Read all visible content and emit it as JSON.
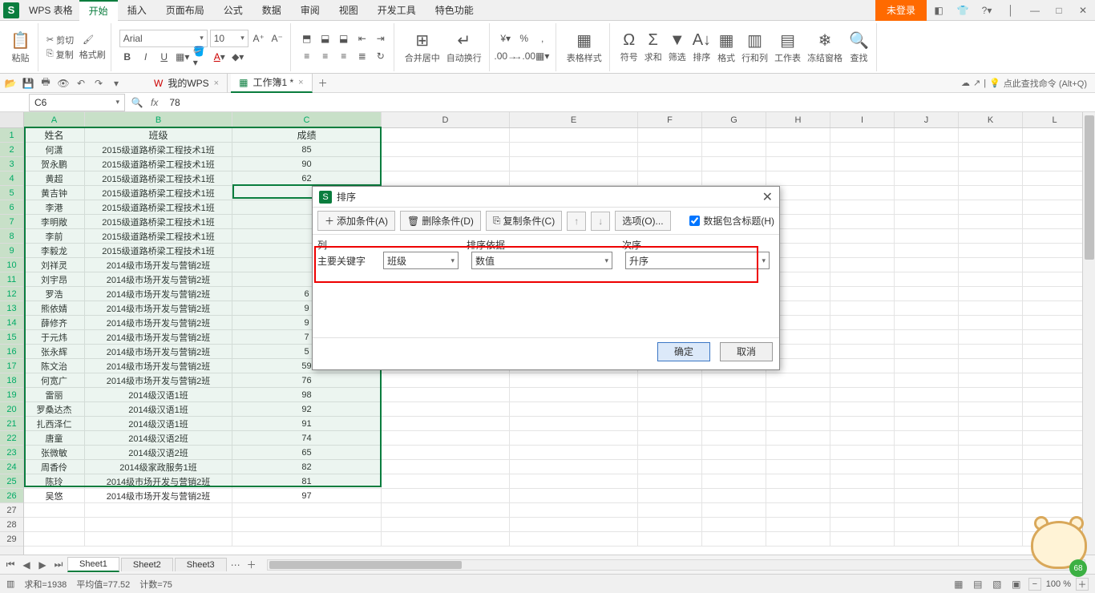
{
  "app": {
    "title": "WPS 表格",
    "login": "未登录"
  },
  "menu": {
    "tabs": [
      "开始",
      "插入",
      "页面布局",
      "公式",
      "数据",
      "审阅",
      "视图",
      "开发工具",
      "特色功能"
    ]
  },
  "ribbon": {
    "paste": "粘贴",
    "cut": "剪切",
    "copy": "复制",
    "fmtpaint": "格式刷",
    "font": "Arial",
    "size": "10",
    "merge": "合并居中",
    "wrap": "自动换行",
    "tablestyle": "表格样式",
    "symbol": "符号",
    "sum": "求和",
    "filter": "筛选",
    "sort": "排序",
    "format": "格式",
    "rowcol": "行和列",
    "worksheet": "工作表",
    "freeze": "冻结窗格",
    "find": "查找"
  },
  "qat": {
    "search": "点此查找命令 (Alt+Q)"
  },
  "doctabs": {
    "wps": "我的WPS",
    "book": "工作簿1 *"
  },
  "namebox": "C6",
  "formula": "78",
  "columns": [
    "A",
    "B",
    "C",
    "D",
    "E",
    "F",
    "G",
    "H",
    "I",
    "J",
    "K",
    "L"
  ],
  "headers": {
    "name": "姓名",
    "class": "班级",
    "score": "成绩"
  },
  "rows": [
    {
      "a": "何潇",
      "b": "2015级道路桥梁工程技术1班",
      "c": "85"
    },
    {
      "a": "贺永鹏",
      "b": "2015级道路桥梁工程技术1班",
      "c": "90"
    },
    {
      "a": "黄超",
      "b": "2015级道路桥梁工程技术1班",
      "c": "62"
    },
    {
      "a": "黄吉钟",
      "b": "2015级道路桥梁工程技术1班",
      "c": ""
    },
    {
      "a": "李港",
      "b": "2015级道路桥梁工程技术1班",
      "c": ""
    },
    {
      "a": "李明敞",
      "b": "2015级道路桥梁工程技术1班",
      "c": ""
    },
    {
      "a": "李前",
      "b": "2015级道路桥梁工程技术1班",
      "c": ""
    },
    {
      "a": "李毅龙",
      "b": "2015级道路桥梁工程技术1班",
      "c": ""
    },
    {
      "a": "刘祥灵",
      "b": "2014级市场开发与营销2班",
      "c": ""
    },
    {
      "a": "刘宇昂",
      "b": "2014级市场开发与营销2班",
      "c": ""
    },
    {
      "a": "罗浩",
      "b": "2014级市场开发与营销2班",
      "c": "6"
    },
    {
      "a": "熊依婧",
      "b": "2014级市场开发与营销2班",
      "c": "9"
    },
    {
      "a": "薛修齐",
      "b": "2014级市场开发与营销2班",
      "c": "9"
    },
    {
      "a": "于元炜",
      "b": "2014级市场开发与营销2班",
      "c": "7"
    },
    {
      "a": "张永辉",
      "b": "2014级市场开发与营销2班",
      "c": "5"
    },
    {
      "a": "陈文治",
      "b": "2014级市场开发与营销2班",
      "c": "59"
    },
    {
      "a": "何宽广",
      "b": "2014级市场开发与营销2班",
      "c": "76"
    },
    {
      "a": "雷丽",
      "b": "2014级汉语1班",
      "c": "98"
    },
    {
      "a": "罗桑达杰",
      "b": "2014级汉语1班",
      "c": "92"
    },
    {
      "a": "扎西泽仁",
      "b": "2014级汉语1班",
      "c": "91"
    },
    {
      "a": "唐童",
      "b": "2014级汉语2班",
      "c": "74"
    },
    {
      "a": "张微敏",
      "b": "2014级汉语2班",
      "c": "65"
    },
    {
      "a": "周香伶",
      "b": "2014级家政服务1班",
      "c": "82"
    },
    {
      "a": "陈玲",
      "b": "2014级市场开发与营销2班",
      "c": "81"
    },
    {
      "a": "吴悠",
      "b": "2014级市场开发与营销2班",
      "c": "97"
    }
  ],
  "dialog": {
    "title": "排序",
    "add": "添加条件(A)",
    "del": "删除条件(D)",
    "copy": "复制条件(C)",
    "options": "选项(O)...",
    "header_chk": "数据包含标题(H)",
    "col_hdr": "列",
    "basis_hdr": "排序依据",
    "order_hdr": "次序",
    "primary": "主要关键字",
    "field": "班级",
    "basis": "数值",
    "order": "升序",
    "ok": "确定",
    "cancel": "取消"
  },
  "sheets": [
    "Sheet1",
    "Sheet2",
    "Sheet3"
  ],
  "status": {
    "sum": "求和=1938",
    "avg": "平均值=77.52",
    "count": "计数=75",
    "zoom": "100 %"
  },
  "mascot_badge": "68"
}
